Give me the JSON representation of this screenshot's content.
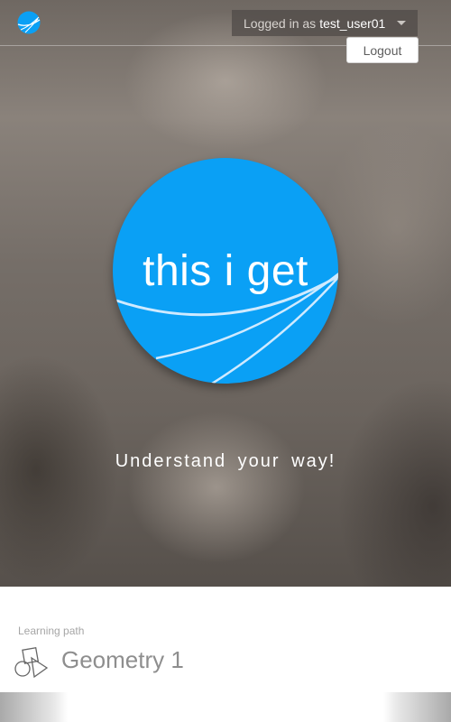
{
  "header": {
    "logged_in_prefix": "Logged in as",
    "username": "test_user01",
    "logout_label": "Logout"
  },
  "hero": {
    "brand": "this i get",
    "tagline": "Understand your way!"
  },
  "learning_path": {
    "label": "Learning path",
    "title": "Geometry 1"
  },
  "colors": {
    "brand_blue": "#0aa0f5"
  },
  "icons": {
    "logo": "planet-logo-icon",
    "user_menu_caret": "chevron-down-icon",
    "learning_path": "geometry-shapes-icon"
  }
}
